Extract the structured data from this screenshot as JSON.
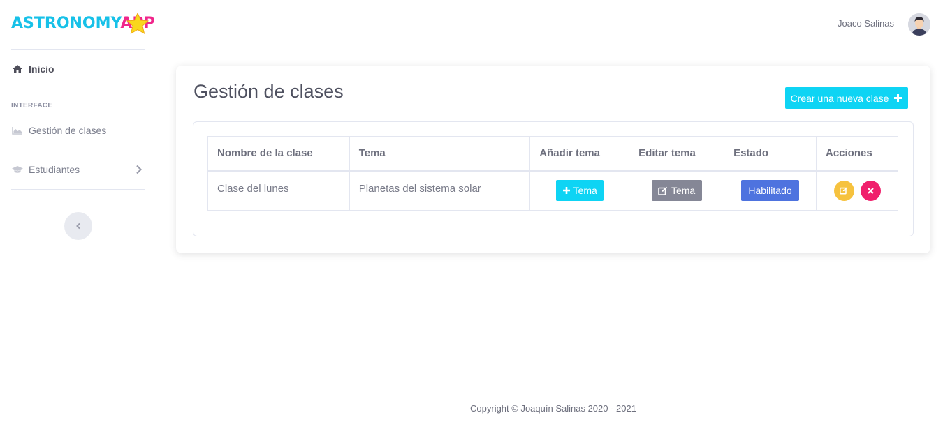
{
  "brand": {
    "part1": "ASTRONOMY",
    "part2": "APP"
  },
  "sidebar": {
    "home_label": "Inicio",
    "heading": "INTERFACE",
    "items": [
      {
        "label": "Gestión de clases",
        "icon": "chart-area-icon"
      },
      {
        "label": "Estudiantes",
        "icon": "graduation-cap-icon"
      }
    ]
  },
  "topbar": {
    "user_name": "Joaco Salinas"
  },
  "main": {
    "title": "Gestión de clases",
    "create_button": "Crear una nueva clase",
    "table": {
      "headers": [
        "Nombre de la clase",
        "Tema",
        "Añadir tema",
        "Editar tema",
        "Estado",
        "Acciones"
      ],
      "rows": [
        {
          "name": "Clase del lunes",
          "tema": "Planetas del sistema solar",
          "add_label": "Tema",
          "edit_label": "Tema",
          "estado": "Habilitado"
        }
      ]
    }
  },
  "footer": {
    "text": "Copyright © Joaquín Salinas 2020 - 2021"
  },
  "colors": {
    "cyan": "#0ed4f4",
    "gray": "#858796",
    "blue": "#4e73df",
    "yellow": "#f6c23e",
    "pink": "#f0206c"
  }
}
